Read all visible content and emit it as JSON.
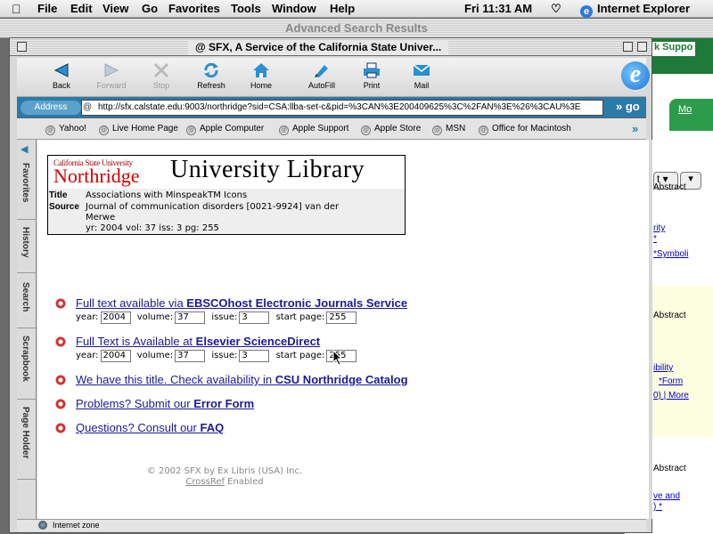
{
  "menubar": {
    "apple": "",
    "items": [
      "File",
      "Edit",
      "View",
      "Go",
      "Favorites",
      "Tools",
      "Window",
      "Help"
    ],
    "clock": "Fri 11:31 AM",
    "app_name": "Internet Explorer"
  },
  "background_window": {
    "title": "Advanced Search Results",
    "support_link": "k Suppo",
    "tab_label": "Mo",
    "select_value": "t",
    "abstract_1": "Abstract",
    "link_1a": "rity",
    "link_1b": "*",
    "link_1c": "*Symboli",
    "abstract_2": "Abstract",
    "link_2a": "ibility",
    "link_2b": "*Form",
    "link_2c": "0) | More",
    "abstract_3": "Abstract",
    "link_3a": "ve and",
    "link_3b": ") *"
  },
  "window": {
    "title": "SFX, A Service of the California State Univer...",
    "toolbar": [
      {
        "label": "Back",
        "icon": "back-arrow-icon",
        "enabled": true
      },
      {
        "label": "Forward",
        "icon": "forward-arrow-icon",
        "enabled": false
      },
      {
        "label": "Stop",
        "icon": "stop-icon",
        "enabled": false
      },
      {
        "label": "Refresh",
        "icon": "refresh-icon",
        "enabled": true
      },
      {
        "label": "Home",
        "icon": "home-icon",
        "enabled": true
      },
      {
        "label": "AutoFill",
        "icon": "autofill-icon",
        "enabled": true
      },
      {
        "label": "Print",
        "icon": "print-icon",
        "enabled": true
      },
      {
        "label": "Mail",
        "icon": "mail-icon",
        "enabled": true
      }
    ],
    "address_label": "Address",
    "address": "http://sfx.calstate.edu:9003/northridge?sid=CSA:llba-set-c&pid=%3CAN%3E200409625%3C%2FAN%3E%26%3CAU%3E",
    "go_label": "go",
    "favorites": [
      "Yahoo!",
      "Live Home Page",
      "Apple Computer",
      "Apple Support",
      "Apple Store",
      "MSN",
      "Office for Macintosh"
    ],
    "side_tabs": [
      "Favorites",
      "History",
      "Search",
      "Scrapbook",
      "Page Holder"
    ],
    "status": "Internet zone"
  },
  "page": {
    "logo_top": "California State University",
    "logo_main": "Northridge",
    "banner": "University Library",
    "meta": {
      "title_key": "Title",
      "title_val": "Associations with MinspeakTM Icons",
      "source_key": "Source",
      "source_line1": "Journal of communication disorders [0021-9924] van der",
      "source_line2": "Merwe",
      "source_line3": "yr: 2004 vol: 37 iss: 3 pg: 255"
    },
    "services": [
      {
        "text": "Full text available via ",
        "bold": "EBSCOhost Electronic Journals Service",
        "has_fields": true
      },
      {
        "text": "Full Text is Available at ",
        "bold": "Elsevier ScienceDirect",
        "has_fields": true
      },
      {
        "text": "We have this title. Check availability in ",
        "bold": "CSU Northridge Catalog",
        "has_fields": false
      },
      {
        "text": "Problems? Submit our ",
        "bold": "Error Form",
        "has_fields": false
      },
      {
        "text": "Questions? Consult our ",
        "bold": "FAQ",
        "has_fields": false
      }
    ],
    "fields": {
      "year_label": "year:",
      "year": "2004",
      "volume_label": "volume:",
      "volume": "37",
      "issue_label": "issue:",
      "issue": "3",
      "start_page_label": "start page:",
      "start_page": "255"
    },
    "footer_line1": "© 2002 SFX by Ex Libris (USA) Inc.",
    "footer_crossref": "CrossRef",
    "footer_enabled": " Enabled"
  },
  "colors": {
    "address_bar": "#2b7aa8",
    "link": "#1a1a9a",
    "logo_red": "#cc0000",
    "bg_green": "#1d7a3a"
  }
}
